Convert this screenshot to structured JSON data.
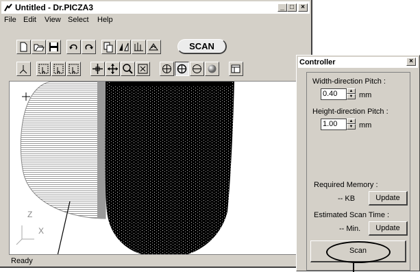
{
  "window": {
    "title": "Untitled - Dr.PICZA3",
    "min_glyph": "_",
    "max_glyph": "□",
    "close_glyph": "×"
  },
  "menu": [
    "File",
    "Edit",
    "View",
    "Select",
    "Help"
  ],
  "toolbar1": {
    "scan_label": "SCAN"
  },
  "viewport": {
    "axis_z": "Z",
    "axis_x": "X"
  },
  "status": "Ready",
  "controller": {
    "title": "Controller",
    "close_glyph": "×",
    "width_pitch_label": "Width-direction Pitch :",
    "width_pitch_value": "0.40",
    "width_unit": "mm",
    "height_pitch_label": "Height-direction Pitch :",
    "height_pitch_value": "1.00",
    "height_unit": "mm",
    "memory_label": "Required Memory :",
    "memory_value": "-- KB",
    "update_label_1": "Update",
    "time_label": "Estimated Scan Time :",
    "time_value": "-- Min.",
    "update_label_2": "Update",
    "scan_label": "Scan"
  },
  "icons": [
    "app-icon",
    "new-file-icon",
    "open-file-icon",
    "save-icon",
    "undo-icon",
    "redo-icon",
    "copy-icon",
    "flip-icon",
    "align-icon",
    "mountain-icon",
    "select-icon",
    "move-icon",
    "pan-icon",
    "zoom-icon",
    "fit-icon",
    "rotate-icon",
    "sphere-icon",
    "settings-icon"
  ]
}
